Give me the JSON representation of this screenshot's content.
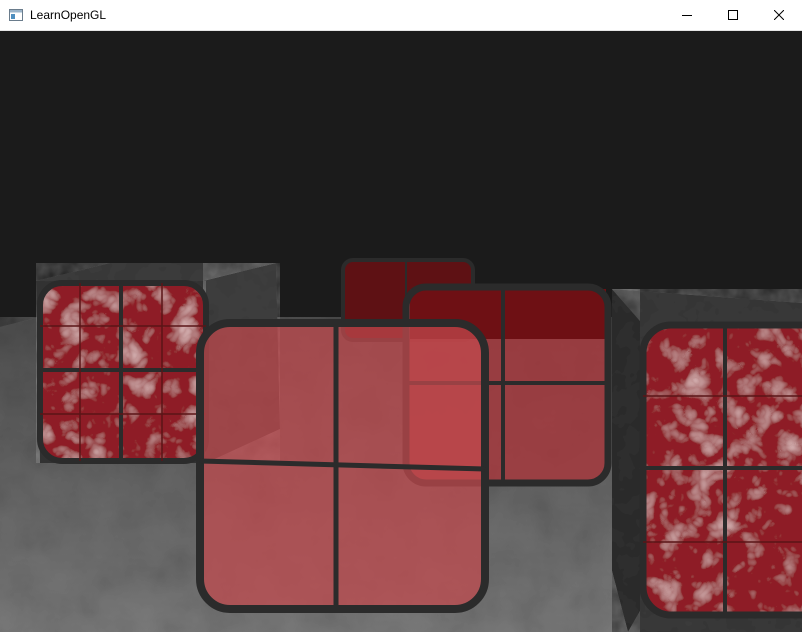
{
  "window": {
    "title": "LearnOpenGL",
    "icon": "app-window-icon",
    "controls": [
      {
        "name": "minimize-icon"
      },
      {
        "name": "maximize-icon"
      },
      {
        "name": "close-icon"
      }
    ]
  },
  "scene": {
    "background_color": "#1b1b1b",
    "floor_color": "#6b6b6b",
    "marble_cube_color": "#3c3c3c",
    "window_frame_color": "#2b2b2b",
    "window_glass_color": "#c0393b"
  }
}
